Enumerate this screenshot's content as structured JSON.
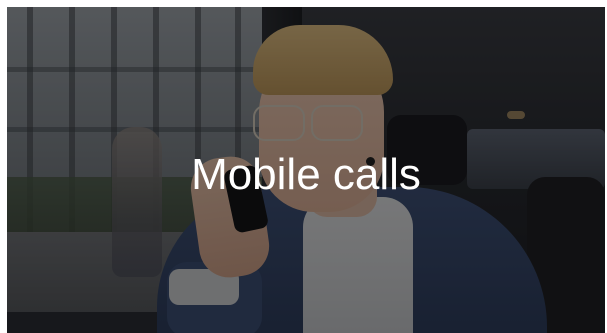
{
  "banner": {
    "caption": "Mobile calls",
    "overlay_color": "#000000",
    "text_color": "#ffffff"
  }
}
